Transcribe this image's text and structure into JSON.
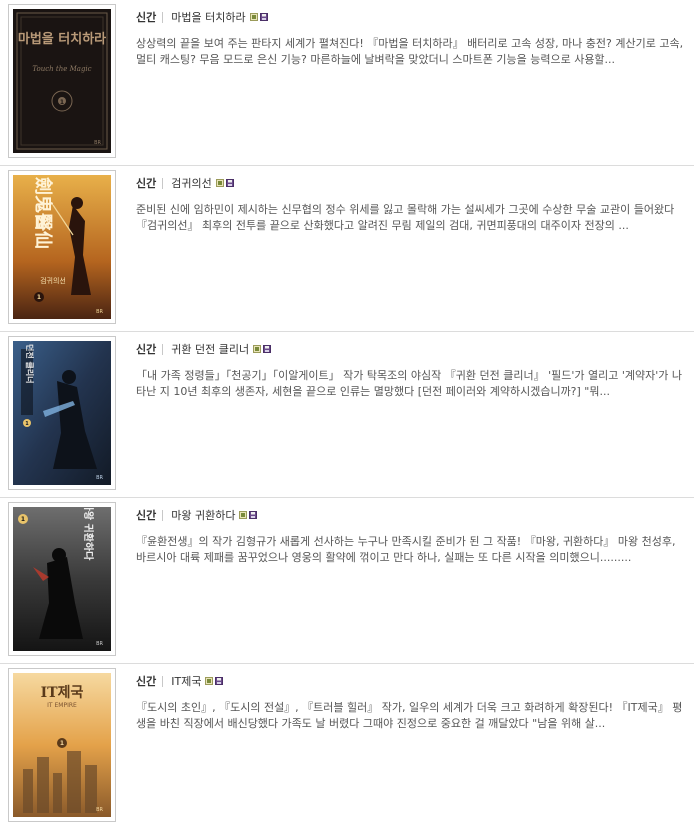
{
  "books": [
    {
      "badge": "신간",
      "title": "마법을 터치하라",
      "description": "상상력의 끝을 보여 주는 판타지 세계가 펼쳐진다! 『마법을 터치하라』 배터리로 고속 성장, 마나 충전? 계산기로 고속, 멀티 캐스팅? 무음 모드로 은신 기능? 마른하늘에 날벼락을 맞았더니 스마트폰 기능을 능력으로 사용할...",
      "cover": {
        "title": "마법을 터치하라",
        "subtitle": "Touch the Magic",
        "volume": "1",
        "publisher": "BR"
      },
      "format_icons": [
        "ebook-icon",
        "save-icon"
      ]
    },
    {
      "badge": "신간",
      "title": "검귀의선",
      "description": "준비된 신에 임하민이 제시하는 신무협의 정수 위세를 잃고 몰락해 가는 설씨세가 그곳에 수상한 무술 교관이 들어왔다 『검귀의선』 최후의 전투를 끝으로 산화했다고 알려진 무림 제일의 검대, 귀면피풍대의 대주이자 전장의 ...",
      "cover": {
        "title": "劍鬼醫仙",
        "subtitle": "검귀의선",
        "volume": "1",
        "publisher": "BR"
      },
      "format_icons": [
        "ebook-icon",
        "save-icon"
      ]
    },
    {
      "badge": "신간",
      "title": "귀환 던전 클리너",
      "description": "「내 가족 정령들」「천공기」「이알게이트」 작가 탁목조의 야심작 『귀환 던전 클리너』 '필드'가 열리고 '계약자'가 나타난 지 10년 최후의 생존자, 세현을 끝으로 인류는 멸망했다 [던전 페이러와 계약하시겠습니까?] \"뭐...",
      "cover": {
        "title": "귀환 던전 클리너",
        "subtitle": "",
        "volume": "1",
        "publisher": "BR"
      },
      "format_icons": [
        "ebook-icon",
        "save-icon"
      ]
    },
    {
      "badge": "신간",
      "title": "마왕 귀환하다",
      "description": "『윤환전생』의 작가 김형규가 새롭게 선사하는 누구나 만족시킬 준비가 된 그 작품! 『마왕, 귀환하다』 마왕 천성후, 바르시아 대륙 제패를 꿈꾸었으나 영웅의 활약에 꺾이고 만다 하나, 실패는 또 다른 시작을 의미했으니.........",
      "cover": {
        "title": "마왕 귀환하다",
        "subtitle": "",
        "volume": "1",
        "publisher": "BR"
      },
      "format_icons": [
        "ebook-icon",
        "save-icon"
      ]
    },
    {
      "badge": "신간",
      "title": "IT제국",
      "description": "『도시의 초인』, 『도시의 전설』, 『트러블 힐러』 작가, 일우의 세계가 더욱 크고 화려하게 확장된다! 『IT제국』 평생을 바친 직장에서 배신당했다 가족도 날 버렸다 그때야 진정으로 중요한 걸 깨달았다 \"남을 위해 살...",
      "cover": {
        "title": "IT제국",
        "subtitle": "IT EMPIRE",
        "volume": "1",
        "publisher": "BR"
      },
      "format_icons": [
        "ebook-icon",
        "save-icon"
      ]
    }
  ],
  "colors": {
    "badge": "#333333",
    "title": "#333333",
    "description": "#555555",
    "divider": "#dcdcdc"
  }
}
